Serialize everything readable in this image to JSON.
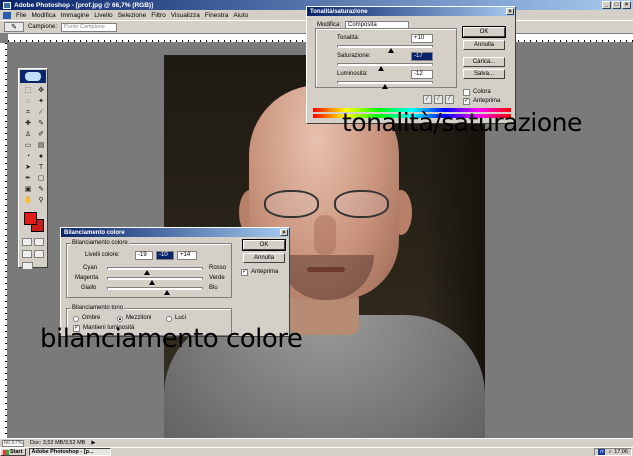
{
  "window": {
    "title": "Adobe Photoshop - [prof.jpg @ 66,7% (RGB)]",
    "controls": [
      "_",
      "□",
      "×"
    ]
  },
  "menubar": [
    "File",
    "Modifica",
    "Immagine",
    "Livello",
    "Selezione",
    "Filtro",
    "Visualizza",
    "Finestra",
    "Aiuto"
  ],
  "options": {
    "tool_glyph": "✎",
    "sample_label": "Campione:",
    "sample_value": "Punto Campione"
  },
  "hue_saturation": {
    "title": "Tonalità/saturazione",
    "edit_label": "Modifica:",
    "edit_value": "Composita",
    "hue_label": "Tonalità:",
    "hue_value": "+10",
    "saturation_label": "Saturazione:",
    "saturation_value": "-17",
    "lightness_label": "Luminosità:",
    "lightness_value": "-12",
    "ok": "OK",
    "cancel": "Annulla",
    "load": "Carica...",
    "save": "Salva...",
    "colorize_label": "Colora",
    "colorize_checked": false,
    "preview_label": "Anteprima",
    "preview_checked": true,
    "close": "×"
  },
  "color_balance": {
    "title": "Bilanciamento colore",
    "group_label": "Bilanciamento colore",
    "levels_label": "Livelli colore:",
    "level_1": "-19",
    "level_2": "-10",
    "level_3": "+14",
    "row1_left": "Cyan",
    "row1_right": "Rosso",
    "row2_left": "Magenta",
    "row2_right": "Verde",
    "row3_left": "Giallo",
    "row3_right": "Blu",
    "tone_group_label": "Bilanciamento tono",
    "shadows": "Ombre",
    "midtones": "Mezzitoni",
    "highlights": "Luci",
    "preserve_label": "Mantieni luminosità",
    "preserve_checked": true,
    "preview_label": "Anteprima",
    "preview_checked": true,
    "ok": "OK",
    "cancel": "Annulla",
    "close": "×"
  },
  "captions": {
    "hue_saturation": "tonalità/saturazione",
    "color_balance": "bilanciamento colore"
  },
  "statusbar": {
    "zoom": "66,67%",
    "doc": "Doc: 3,52 MB/3,52 MB"
  },
  "taskbar": {
    "start": "Start",
    "item": "Adobe Photoshop - [p...",
    "lang": "IT",
    "clock": "17.06"
  },
  "colors": {
    "foreground": "#e21b1b",
    "titlebar": "#0a246a"
  }
}
